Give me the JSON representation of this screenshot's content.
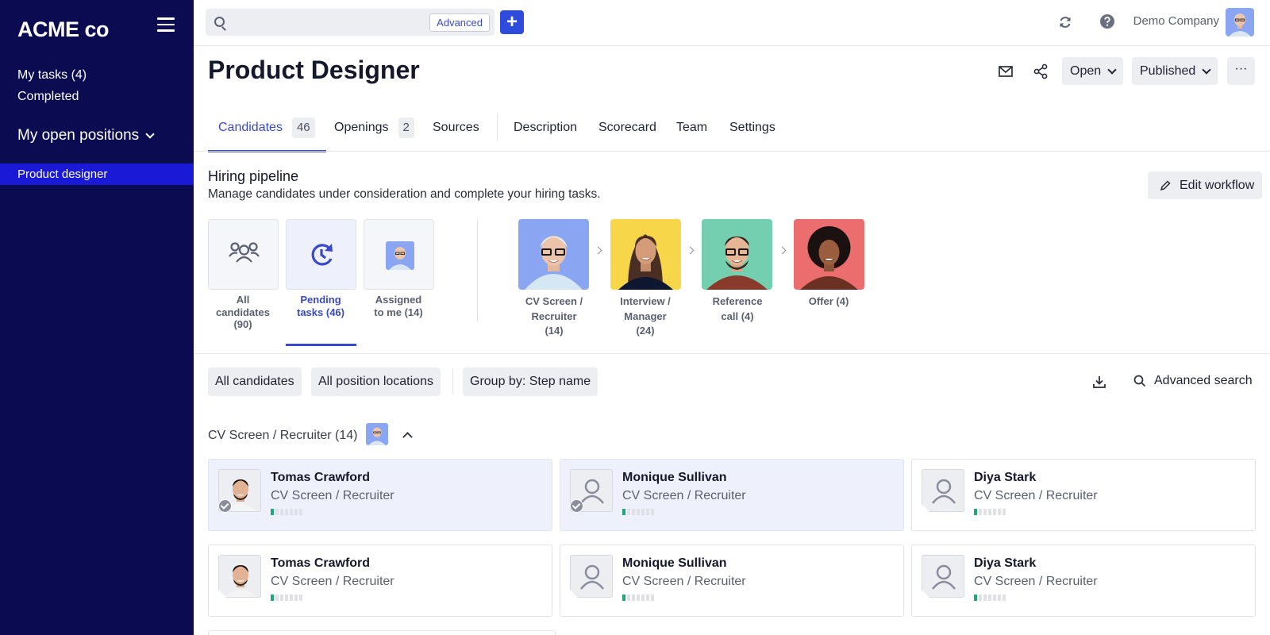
{
  "sidebar": {
    "logo": "ACME co",
    "my_tasks": "My tasks (4)",
    "completed": "Completed",
    "section": "My open positions",
    "active_item": "Product designer"
  },
  "topbar": {
    "search_value": "",
    "advanced_label": "Advanced",
    "add_label": "+",
    "company": "Demo Company"
  },
  "header": {
    "title": "Product Designer",
    "status_dropdown": "Open",
    "publish_dropdown": "Published",
    "more_label": "···"
  },
  "tabs": [
    {
      "label": "Candidates",
      "count": "46"
    },
    {
      "label": "Openings",
      "count": "2"
    },
    {
      "label": "Sources"
    },
    {
      "label": "Description"
    },
    {
      "label": "Scorecard"
    },
    {
      "label": "Team"
    },
    {
      "label": "Settings"
    }
  ],
  "pipeline": {
    "title": "Hiring pipeline",
    "subtitle": "Manage candidates under consideration and complete your hiring tasks.",
    "edit_workflow": "Edit workflow",
    "filters": [
      {
        "line1": "All",
        "line2": "candidates",
        "line3": "(90)"
      },
      {
        "line1": "Pending",
        "line2": "tasks (46)"
      },
      {
        "line1": "Assigned",
        "line2": "to me (14)"
      }
    ],
    "stages": [
      {
        "line1": "CV Screen /",
        "line2": "Recruiter",
        "line3": "(14)"
      },
      {
        "line1": "Interview /",
        "line2": "Manager",
        "line3": "(24)"
      },
      {
        "line1": "Reference",
        "line2": "call (4)"
      },
      {
        "line1": "Offer (4)"
      }
    ]
  },
  "filters_row": {
    "chips": [
      "All candidates",
      "All position locations",
      "Group by: Step name"
    ],
    "advanced_search": "Advanced search"
  },
  "group": {
    "label": "CV Screen / Recruiter (14)"
  },
  "candidates": [
    {
      "name": "Tomas Crawford",
      "step": "CV Screen / Recruiter",
      "progress": 0.14
    },
    {
      "name": "Monique Sullivan",
      "step": "CV Screen / Recruiter",
      "progress": 0.14
    },
    {
      "name": "Diya Stark",
      "step": "CV Screen / Recruiter",
      "progress": 0.14
    },
    {
      "name": "Tomas Crawford",
      "step": "CV Screen / Recruiter",
      "progress": 0.14
    },
    {
      "name": "Monique Sullivan",
      "step": "CV Screen / Recruiter",
      "progress": 0.14
    },
    {
      "name": "Diya Stark",
      "step": "CV Screen / Recruiter",
      "progress": 0.14
    }
  ],
  "colors": {
    "sidebar_bg": "#0b0b52",
    "sidebar_active": "#1a1ad6",
    "accent": "#3a49c9",
    "primary_button": "#2f4bdc",
    "progress_on": "#1fa67a"
  }
}
